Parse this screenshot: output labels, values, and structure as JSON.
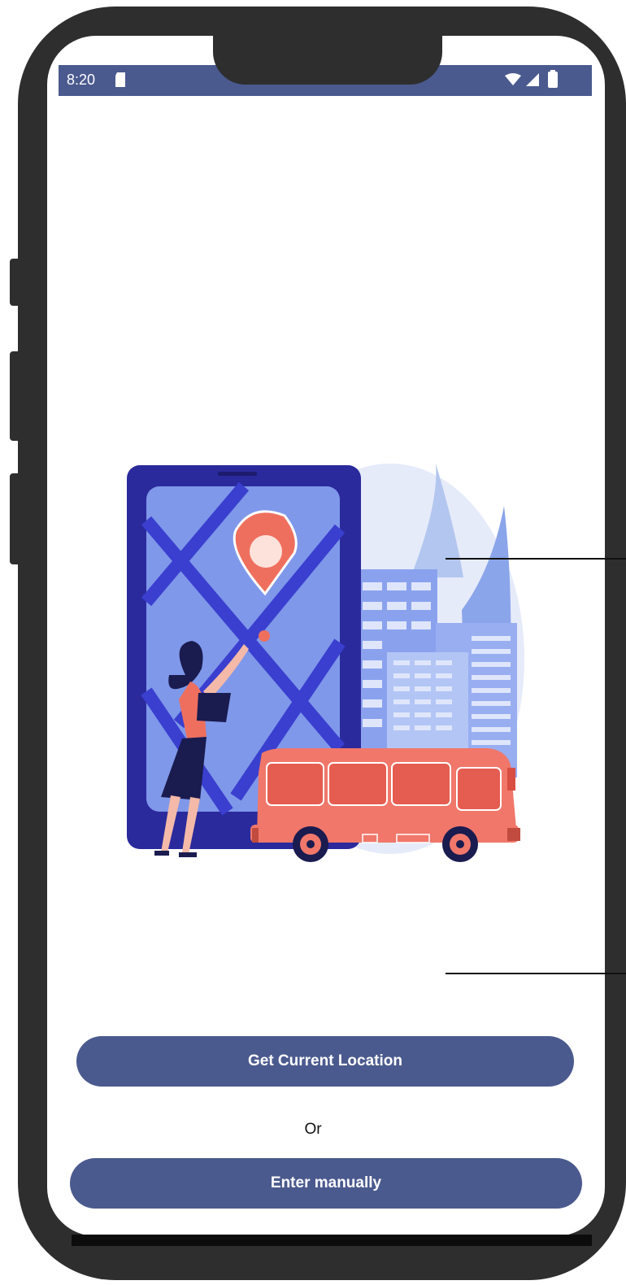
{
  "status_bar": {
    "time": "8:20",
    "icons": [
      "sd-card-icon",
      "wifi-icon",
      "signal-icon",
      "battery-icon"
    ],
    "background": "#4a5a8f"
  },
  "illustration": {
    "description_icon": "location-map-bus-illustration-icon"
  },
  "actions": {
    "get_location_label": "Get Current Location",
    "or_label": "Or",
    "enter_manually_label": "Enter manually",
    "button_color": "#4b5a8e"
  }
}
